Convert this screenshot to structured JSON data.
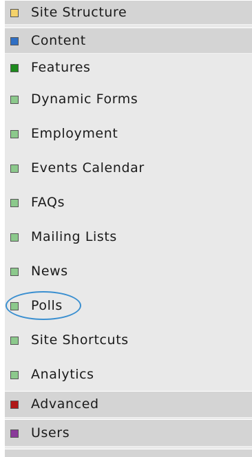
{
  "menu": {
    "items": [
      {
        "label": "Site Structure",
        "color": "#f4d26b",
        "kind": "section"
      },
      {
        "label": "Content",
        "color": "#2f6fc4",
        "kind": "section"
      },
      {
        "label": "Features",
        "color": "#1e8a1e",
        "kind": "sub"
      },
      {
        "label": "Dynamic Forms",
        "color": "#8cc98c",
        "kind": "sub"
      },
      {
        "label": "Employment",
        "color": "#8cc98c",
        "kind": "sub"
      },
      {
        "label": "Events Calendar",
        "color": "#8cc98c",
        "kind": "sub"
      },
      {
        "label": "FAQs",
        "color": "#8cc98c",
        "kind": "sub"
      },
      {
        "label": "Mailing Lists",
        "color": "#8cc98c",
        "kind": "sub"
      },
      {
        "label": "News",
        "color": "#8cc98c",
        "kind": "sub"
      },
      {
        "label": "Polls",
        "color": "#8cc98c",
        "kind": "sub",
        "highlighted": true
      },
      {
        "label": "Site Shortcuts",
        "color": "#8cc98c",
        "kind": "sub"
      },
      {
        "label": "Analytics",
        "color": "#8cc98c",
        "kind": "sub"
      },
      {
        "label": "Advanced",
        "color": "#b01818",
        "kind": "section"
      },
      {
        "label": "Users",
        "color": "#8a3a9a",
        "kind": "section"
      }
    ]
  },
  "highlight": {
    "color": "#3a8fd0",
    "target": "Polls"
  }
}
